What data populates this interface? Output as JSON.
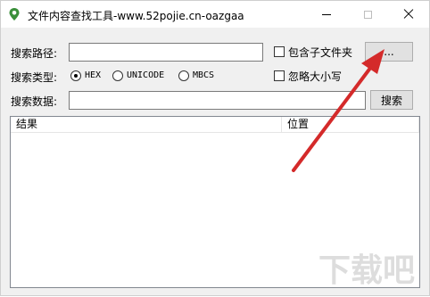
{
  "window": {
    "title": "文件内容查找工具-www.52pojie.cn-oazgaa",
    "min_icon": "minimize-icon",
    "max_icon": "maximize-icon",
    "close_icon": "close-icon"
  },
  "form": {
    "path_label": "搜索路径:",
    "path_value": "",
    "include_subfolders_label": "包含子文件夹",
    "include_subfolders_checked": false,
    "browse_label": "...",
    "type_label": "搜索类型:",
    "types": [
      {
        "label": "HEX",
        "selected": true
      },
      {
        "label": "UNICODE",
        "selected": false
      },
      {
        "label": "MBCS",
        "selected": false
      }
    ],
    "ignore_case_label": "忽略大小写",
    "ignore_case_checked": false,
    "data_label": "搜索数据:",
    "data_value": "",
    "search_label": "搜索"
  },
  "results": {
    "columns": [
      "结果",
      "位置"
    ],
    "rows": []
  },
  "annotation": {
    "arrow_color": "#d42a2a"
  },
  "watermark": {
    "text": "下载吧"
  }
}
